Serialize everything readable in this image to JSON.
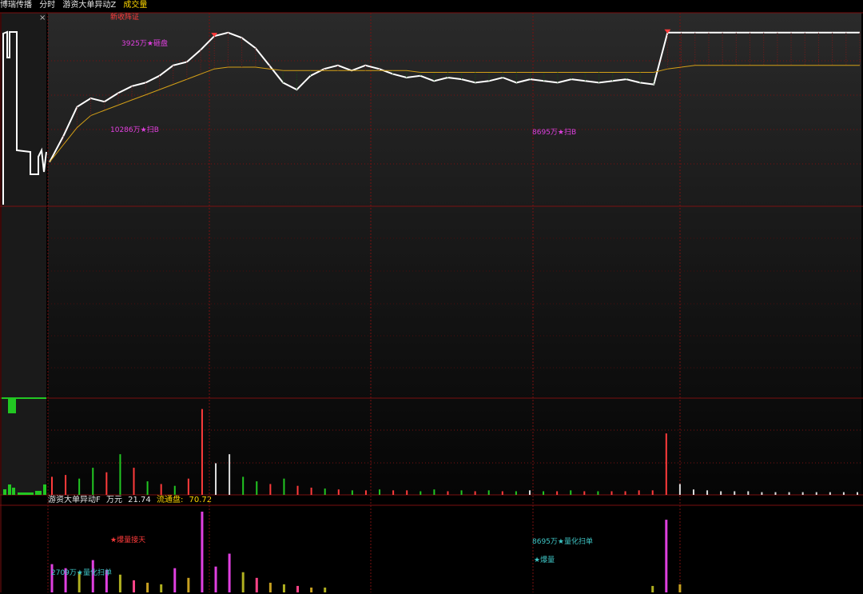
{
  "header": {
    "stock_name": "博瑞传播",
    "period": "分时",
    "indicator": "游资大单异动Z",
    "volume_label": "成交量",
    "close_symbol": "×"
  },
  "sub_indicator": {
    "name": "游资大单异动F",
    "unit": "万元",
    "value": "21.74",
    "float_label": "流通盘:",
    "float_value": "70.72"
  },
  "colors": {
    "background": "#000000",
    "grid": "#7a1010",
    "price_line": "#ffffff",
    "avg_line": "#d4a017",
    "up": "#ff3b3b",
    "down": "#22c722",
    "magenta": "#e040e0",
    "cyan": "#3fc7c7"
  },
  "chart_data": [
    {
      "type": "line",
      "name": "intraday",
      "series": [
        {
          "name": "price",
          "values": [
            0.2,
            0.35,
            0.52,
            0.57,
            0.55,
            0.6,
            0.64,
            0.66,
            0.7,
            0.76,
            0.78,
            0.85,
            0.93,
            0.95,
            0.92,
            0.86,
            0.76,
            0.66,
            0.62,
            0.7,
            0.74,
            0.76,
            0.73,
            0.76,
            0.74,
            0.71,
            0.69,
            0.7,
            0.67,
            0.69,
            0.68,
            0.66,
            0.67,
            0.69,
            0.66,
            0.68,
            0.67,
            0.66,
            0.68,
            0.67,
            0.66,
            0.67,
            0.68,
            0.66,
            0.65,
            0.95,
            0.95,
            0.95,
            0.95,
            0.95,
            0.95,
            0.95,
            0.95,
            0.95,
            0.95,
            0.95,
            0.95,
            0.95,
            0.95,
            0.95
          ]
        },
        {
          "name": "avg",
          "values": [
            0.2,
            0.3,
            0.4,
            0.47,
            0.5,
            0.53,
            0.56,
            0.59,
            0.62,
            0.65,
            0.68,
            0.71,
            0.74,
            0.75,
            0.75,
            0.75,
            0.74,
            0.73,
            0.73,
            0.73,
            0.73,
            0.73,
            0.73,
            0.73,
            0.73,
            0.73,
            0.73,
            0.72,
            0.72,
            0.72,
            0.72,
            0.72,
            0.72,
            0.72,
            0.72,
            0.72,
            0.72,
            0.72,
            0.72,
            0.72,
            0.72,
            0.72,
            0.72,
            0.72,
            0.72,
            0.74,
            0.75,
            0.76,
            0.76,
            0.76,
            0.76,
            0.76,
            0.76,
            0.76,
            0.76,
            0.76,
            0.76,
            0.76,
            0.76,
            0.76
          ]
        }
      ],
      "annotations": [
        "新收阵证",
        "3925万★砸盘",
        "10286万★扫B",
        "8695万★扫B"
      ]
    },
    {
      "type": "bar",
      "name": "volume",
      "values": [
        0.2,
        0.22,
        0.18,
        0.3,
        0.25,
        0.45,
        0.3,
        0.15,
        0.12,
        0.1,
        0.18,
        0.95,
        0.35,
        0.45,
        0.2,
        0.15,
        0.12,
        0.18,
        0.1,
        0.08,
        0.07,
        0.06,
        0.05,
        0.05,
        0.06,
        0.05,
        0.05,
        0.04,
        0.06,
        0.04,
        0.05,
        0.04,
        0.05,
        0.04,
        0.04,
        0.05,
        0.04,
        0.04,
        0.05,
        0.04,
        0.04,
        0.04,
        0.04,
        0.05,
        0.05,
        0.68,
        0.12,
        0.06,
        0.05,
        0.04,
        0.04,
        0.04,
        0.03,
        0.03,
        0.03,
        0.03,
        0.03,
        0.03,
        0.03,
        0.03
      ],
      "colors": [
        "up",
        "up",
        "down",
        "down",
        "up",
        "down",
        "up",
        "down",
        "up",
        "down",
        "up",
        "up",
        "neutral",
        "neutral",
        "down",
        "down",
        "up",
        "down",
        "up",
        "up",
        "down",
        "up",
        "down",
        "up",
        "down",
        "up",
        "up",
        "down",
        "down",
        "up",
        "down",
        "up",
        "down",
        "up",
        "down",
        "neutral",
        "down",
        "up",
        "down",
        "up",
        "down",
        "up",
        "up",
        "up",
        "up",
        "up",
        "neutral",
        "neutral",
        "neutral",
        "neutral",
        "neutral",
        "neutral",
        "neutral",
        "neutral",
        "neutral",
        "neutral",
        "neutral",
        "neutral",
        "neutral",
        "neutral"
      ]
    },
    {
      "type": "bar",
      "name": "sub_indicator",
      "values": [
        0.35,
        0.3,
        0.25,
        0.4,
        0.28,
        0.22,
        0.15,
        0.12,
        0.1,
        0.3,
        0.18,
        1.0,
        0.32,
        0.48,
        0.25,
        0.18,
        0.12,
        0.1,
        0.08,
        0.06,
        0.06,
        0.0,
        0.0,
        0.0,
        0.0,
        0.0,
        0.0,
        0.0,
        0.0,
        0.0,
        0.0,
        0.0,
        0.0,
        0.0,
        0.0,
        0.0,
        0.0,
        0.0,
        0.0,
        0.0,
        0.0,
        0.0,
        0.0,
        0.0,
        0.08,
        0.9,
        0.1,
        0.0,
        0.0,
        0.0,
        0.0,
        0.0,
        0.0,
        0.0,
        0.0,
        0.0,
        0.0,
        0.0,
        0.0,
        0.0
      ],
      "annotations": [
        "★爆量接天",
        "2709万★量化扫单",
        "8695万★量化扫单",
        "★爆量"
      ]
    }
  ]
}
